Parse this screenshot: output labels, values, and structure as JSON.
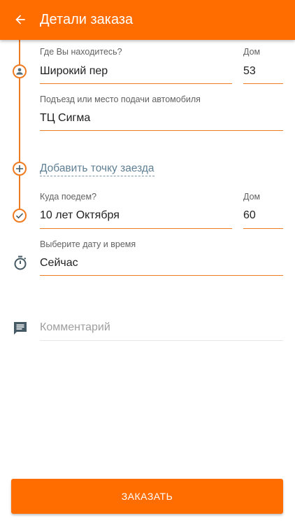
{
  "header": {
    "title": "Детали заказа",
    "back_icon": "arrow-back-icon"
  },
  "pickup": {
    "label": "Где Вы находитесь?",
    "street": "Широкий пер",
    "house_label": "Дом",
    "house": "53",
    "entrance_label": "Подъезд или место подачи автомобиля",
    "entrance": "ТЦ Сигма",
    "icon": "person-icon"
  },
  "add_stop": {
    "label": "Добавить точку заезда",
    "icon": "plus-circle-icon"
  },
  "destination": {
    "label": "Куда поедем?",
    "street": "10 лет Октября",
    "house_label": "Дом",
    "house": "60",
    "icon": "check-circle-icon"
  },
  "datetime": {
    "label": "Выберите дату и время",
    "value": "Сейчас",
    "icon": "stopwatch-icon"
  },
  "comment": {
    "placeholder": "Комментарий",
    "icon": "comment-icon"
  },
  "order_button": {
    "label": "ЗАКАЗАТЬ"
  },
  "colors": {
    "accent": "#ff6d00",
    "line": "#ef7b20",
    "link": "#5f7f94",
    "icon_gray": "#455a64"
  }
}
